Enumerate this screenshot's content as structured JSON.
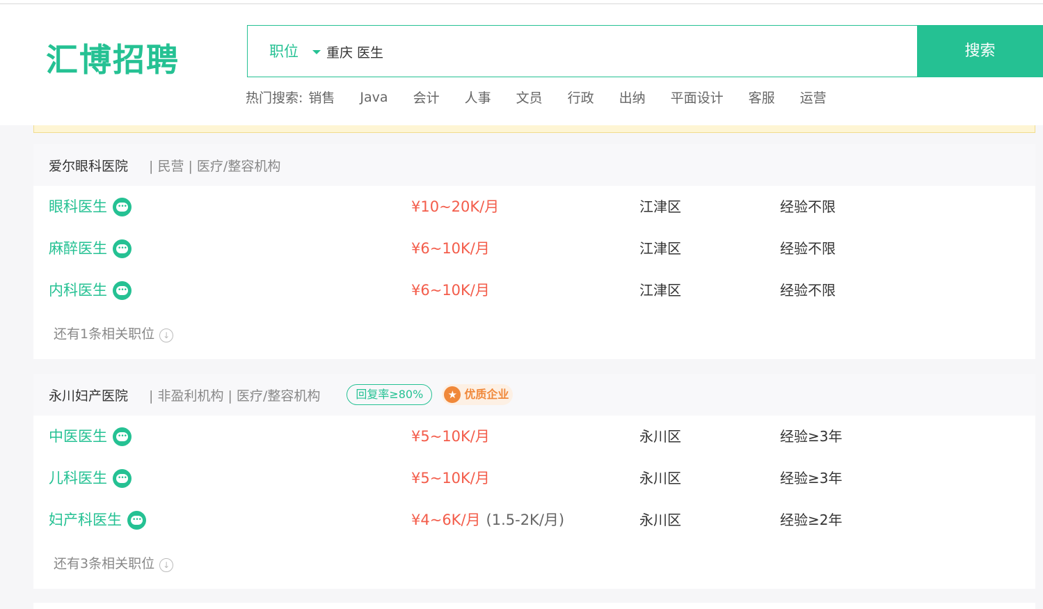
{
  "site": {
    "logo": "汇博招聘"
  },
  "search": {
    "type_label": "职位",
    "query": "重庆 医生",
    "button_label": "搜索",
    "hot_label": "热门搜索:",
    "hot_items": [
      "销售",
      "Java",
      "会计",
      "人事",
      "文员",
      "行政",
      "出纳",
      "平面设计",
      "客服",
      "运营"
    ]
  },
  "companies": [
    {
      "name": "爱尔眼科医院",
      "meta": "| 民营 | 医疗/整容机构",
      "jobs": [
        {
          "title": "眼科医生",
          "salary": "¥10~20K/月",
          "salary_extra": "",
          "district": "江津区",
          "experience": "经验不限"
        },
        {
          "title": "麻醉医生",
          "salary": "¥6~10K/月",
          "salary_extra": "",
          "district": "江津区",
          "experience": "经验不限"
        },
        {
          "title": "内科医生",
          "salary": "¥6~10K/月",
          "salary_extra": "",
          "district": "江津区",
          "experience": "经验不限"
        }
      ],
      "more_text": "还有1条相关职位"
    },
    {
      "name": "永川妇产医院",
      "meta": "| 非盈利机构 | 医疗/整容机构",
      "reply_badge": "回复率≥80%",
      "quality_badge": "优质企业",
      "jobs": [
        {
          "title": "中医医生",
          "salary": "¥5~10K/月",
          "salary_extra": "",
          "district": "永川区",
          "experience": "经验≥3年"
        },
        {
          "title": "儿科医生",
          "salary": "¥5~10K/月",
          "salary_extra": "",
          "district": "永川区",
          "experience": "经验≥3年"
        },
        {
          "title": "妇产科医生",
          "salary": "¥4~6K/月",
          "salary_extra": "(1.5-2K/月)",
          "district": "永川区",
          "experience": "经验≥2年"
        }
      ],
      "more_text": "还有3条相关职位"
    }
  ],
  "colors": {
    "brand": "#25c193",
    "salary": "#f35c4a",
    "quality": "#f0883a"
  }
}
